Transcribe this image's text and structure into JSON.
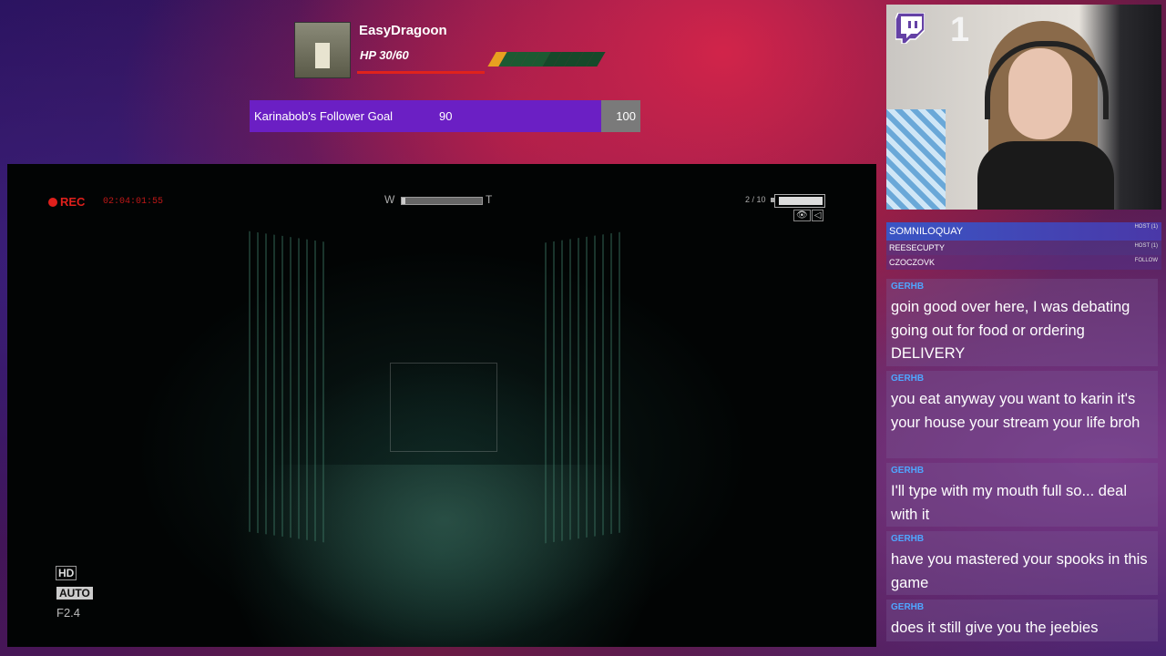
{
  "alert": {
    "username": "EasyDragoon",
    "hp_text": "HP 30/60",
    "hp_fraction": 0.5
  },
  "goal": {
    "label": "Karinabob's Follower Goal",
    "current": "90",
    "target": "100",
    "fraction": 0.9
  },
  "game_hud": {
    "rec_label": "REC",
    "rec_time": "02:04:01:55",
    "zoom_w": "W",
    "zoom_t": "T",
    "zoom_level": 0.05,
    "battery_count": "2 / 10",
    "battery_level": 0.95,
    "hd_label": "HD",
    "auto_label": "AUTO",
    "fstop": "F2.4"
  },
  "webcam": {
    "viewer_count": "1"
  },
  "recent_events": [
    {
      "name": "SOMNILOQUAY",
      "tag": "HOST (1)"
    },
    {
      "name": "REESECUPTY",
      "tag": "HOST (1)"
    },
    {
      "name": "CZOCZOVK",
      "tag": "FOLLOW"
    }
  ],
  "chat": [
    {
      "user": "GERHB",
      "text": "goin good over here, I was debating going out for food or ordering DELIVERY"
    },
    {
      "user": "GERHB",
      "text": "you eat anyway you want to karin it's your house your stream your life broh"
    },
    {
      "user": "GERHB",
      "text": "I'll type with my mouth full so... deal with it"
    },
    {
      "user": "GERHB",
      "text": "have you mastered your spooks in this game"
    },
    {
      "user": "GERHB",
      "text": "does it still give you the jeebies"
    }
  ],
  "colors": {
    "twitch_purple": "#6441a5",
    "rec_red": "#e0201c",
    "goal_purple": "#6b1fc4",
    "chat_username": "#4fa6ff"
  }
}
